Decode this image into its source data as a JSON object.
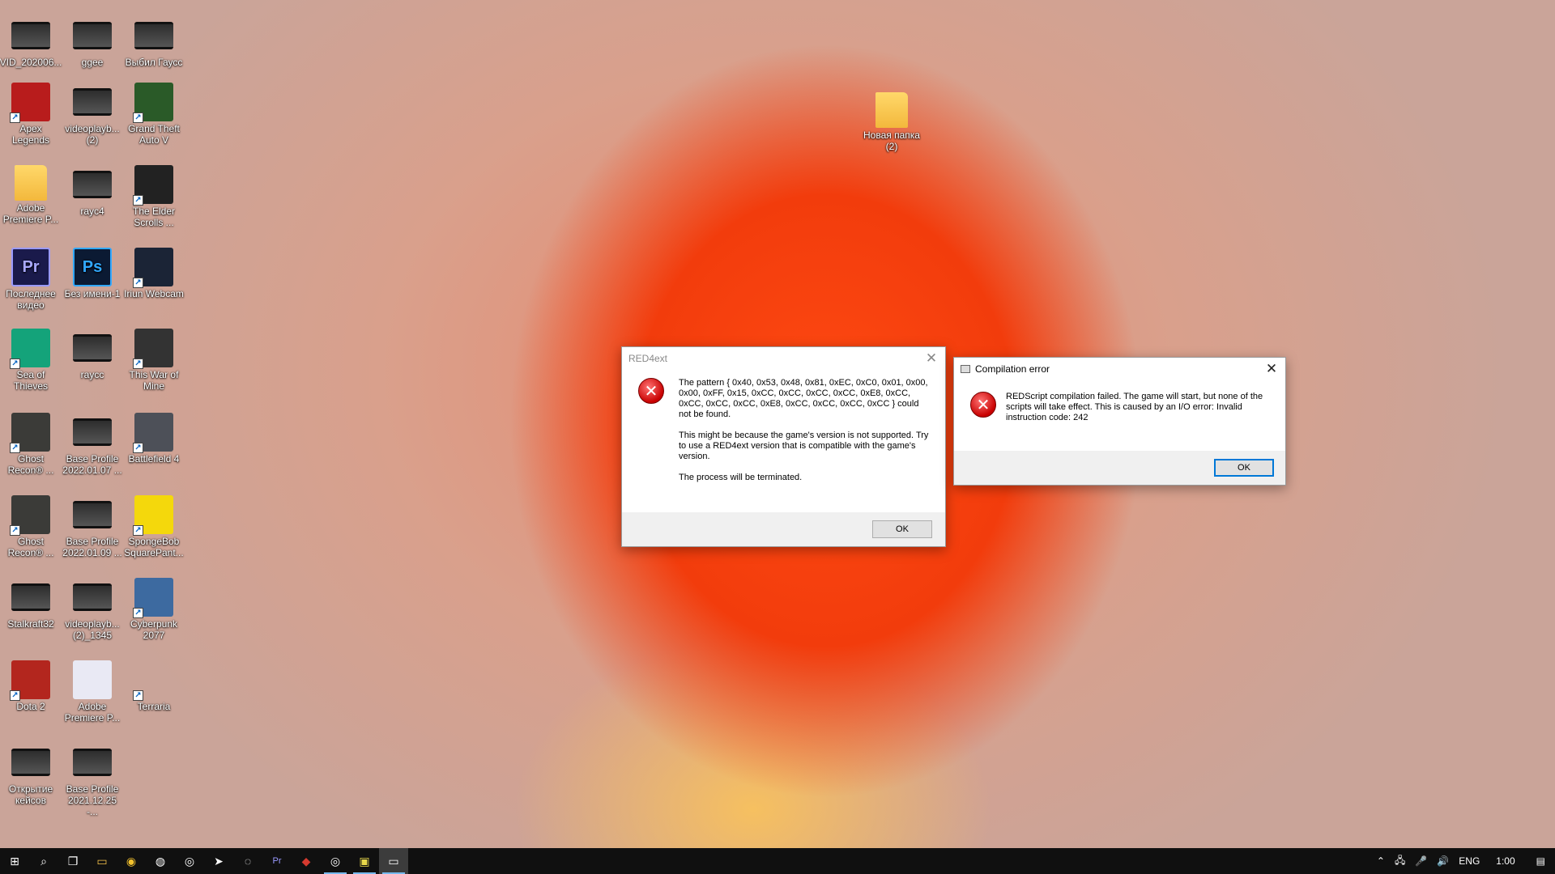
{
  "desktop": {
    "icons": [
      {
        "label": "VID_202006...",
        "icon": "video-thumbnail-icon",
        "shortcut": false
      },
      {
        "label": "ggee",
        "icon": "video-thumbnail-icon",
        "shortcut": false
      },
      {
        "label": "Выбил Гаусс",
        "icon": "video-thumbnail-icon",
        "shortcut": false
      },
      {
        "label": "Apex Legends",
        "icon": "apex-legends-icon",
        "shortcut": true
      },
      {
        "label": "videoplayb... (2)",
        "icon": "video-thumbnail-icon",
        "shortcut": false
      },
      {
        "label": "Grand Theft Auto V",
        "icon": "gta-v-icon",
        "shortcut": true
      },
      {
        "label": "Adobe Premiere P...",
        "icon": "folder-icon",
        "shortcut": false
      },
      {
        "label": "rayc4",
        "icon": "image-thumbnail-icon",
        "shortcut": false
      },
      {
        "label": "The Elder Scrolls ...",
        "icon": "skyrim-icon",
        "shortcut": true
      },
      {
        "label": "Последнее видео",
        "icon": "premiere-project-icon",
        "badge": "Pr",
        "shortcut": false
      },
      {
        "label": "Без имени-1",
        "icon": "photoshop-document-icon",
        "badge": "Ps",
        "shortcut": false
      },
      {
        "label": "Iriun Webcam",
        "icon": "iriun-webcam-icon",
        "shortcut": true
      },
      {
        "label": "Sea of Thieves",
        "icon": "sea-of-thieves-icon",
        "shortcut": true
      },
      {
        "label": "raycc",
        "icon": "video-thumbnail-icon",
        "shortcut": false
      },
      {
        "label": "This War of Mine",
        "icon": "this-war-of-mine-icon",
        "shortcut": true
      },
      {
        "label": "Ghost Recon® ...",
        "icon": "ghost-recon-icon",
        "shortcut": true
      },
      {
        "label": "Base Profile 2022.01.07 ...",
        "icon": "image-thumbnail-icon",
        "shortcut": false
      },
      {
        "label": "Battlefield 4",
        "icon": "battlefield-4-icon",
        "shortcut": true
      },
      {
        "label": "Ghost Recon® ...",
        "icon": "ghost-recon-icon",
        "shortcut": true
      },
      {
        "label": "Base Profile 2022.01.09 ...",
        "icon": "image-thumbnail-icon",
        "shortcut": false
      },
      {
        "label": "SpongeBob SquarePant...",
        "icon": "spongebob-icon",
        "shortcut": true
      },
      {
        "label": "Stalkraft32",
        "icon": "image-thumbnail-icon",
        "shortcut": false
      },
      {
        "label": "videoplayb... (2)_1345",
        "icon": "video-thumbnail-icon",
        "shortcut": false
      },
      {
        "label": "Cyberpunk 2077",
        "icon": "cyberpunk-icon",
        "shortcut": true
      },
      {
        "label": "Dota 2",
        "icon": "dota-2-icon",
        "shortcut": true
      },
      {
        "label": "Adobe Premiere P...",
        "icon": "premiere-installer-icon",
        "shortcut": false
      },
      {
        "label": "Terraria",
        "icon": "terraria-icon",
        "shortcut": true
      },
      {
        "label": "Открытие кейсов",
        "icon": "video-thumbnail-icon",
        "shortcut": false
      },
      {
        "label": "Base Profile 2021.12.25 -...",
        "icon": "image-thumbnail-icon",
        "shortcut": false
      }
    ],
    "folder_icon": {
      "label": "Новая папка (2)",
      "icon": "folder-icon"
    }
  },
  "red4ext_dialog": {
    "title": "RED4ext",
    "message1": "The pattern { 0x40, 0x53, 0x48, 0x81, 0xEC, 0xC0, 0x01, 0x00, 0x00, 0xFF, 0x15, 0xCC, 0xCC, 0xCC, 0xCC, 0xE8, 0xCC, 0xCC, 0xCC, 0xCC, 0xE8, 0xCC, 0xCC, 0xCC, 0xCC } could not be found.",
    "message2": "This might be because the game's version is not supported. Try to use a RED4ext version that is compatible with the game's version.",
    "message3": "The process will be terminated.",
    "ok_label": "OK"
  },
  "compile_dialog": {
    "title": "Compilation error",
    "message": "REDScript compilation failed. The game will start, but none of the scripts will take effect. This is caused by an I/O error: Invalid instruction code: 242",
    "ok_label": "OK"
  },
  "taskbar": {
    "apps": [
      {
        "icon": "windows-start-icon"
      },
      {
        "icon": "search-icon"
      },
      {
        "icon": "task-view-icon"
      },
      {
        "icon": "file-explorer-icon"
      },
      {
        "icon": "chrome-icon"
      },
      {
        "icon": "discord-icon"
      },
      {
        "icon": "steam-icon"
      },
      {
        "icon": "telegram-icon"
      },
      {
        "icon": "obs-icon"
      },
      {
        "icon": "premiere-pro-icon"
      },
      {
        "icon": "game-icon"
      },
      {
        "icon": "steam-running-icon"
      },
      {
        "icon": "cyberpunk-running-icon"
      },
      {
        "icon": "dialog-running-icon"
      }
    ],
    "language": "ENG",
    "time": "1:00"
  },
  "colors": {
    "taskbar_bg": "#101010",
    "active_indicator": "#76b9ed",
    "error_red": "#c80000"
  }
}
